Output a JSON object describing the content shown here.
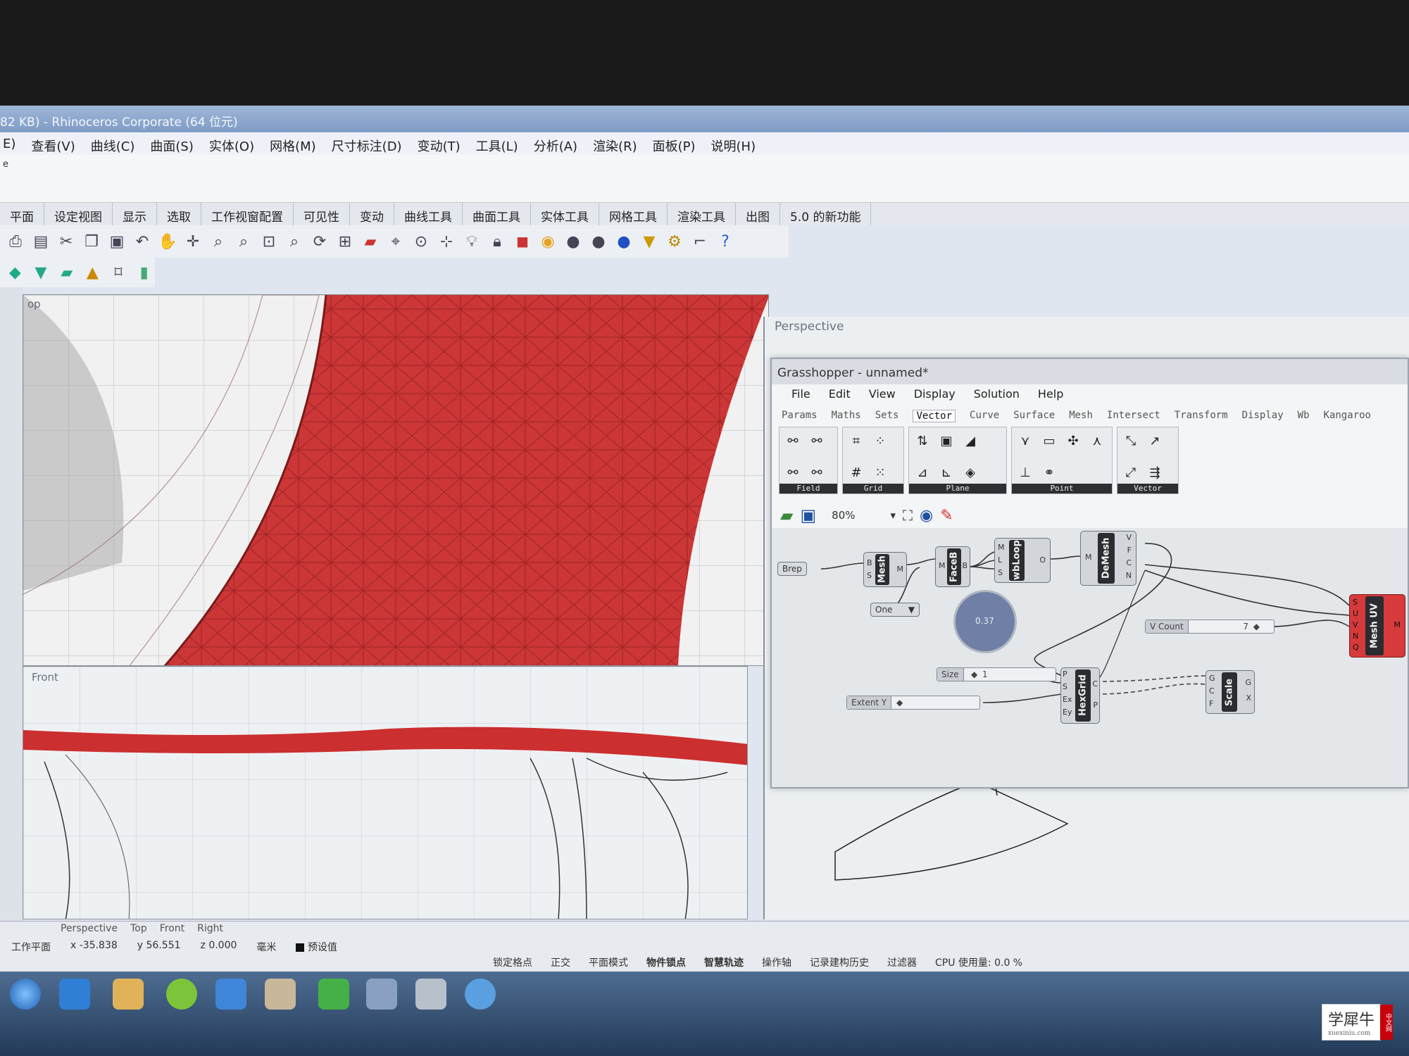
{
  "window": {
    "title": "82 KB) - Rhinoceros Corporate (64 位元)"
  },
  "menubar": {
    "items": [
      "E)",
      "查看(V)",
      "曲线(C)",
      "曲面(S)",
      "实体(O)",
      "网格(M)",
      "尺寸标注(D)",
      "变动(T)",
      "工具(L)",
      "分析(A)",
      "渲染(R)",
      "面板(P)",
      "说明(H)"
    ]
  },
  "command": {
    "prompt": "e"
  },
  "tabbar": {
    "tabs": [
      "平面",
      "设定视图",
      "显示",
      "选取",
      "工作视窗配置",
      "可见性",
      "变动",
      "曲线工具",
      "曲面工具",
      "实体工具",
      "网格工具",
      "渲染工具",
      "出图",
      "5.0 的新功能"
    ]
  },
  "viewports": {
    "top": {
      "label": "op"
    },
    "front": {
      "label": "Front"
    },
    "perspective": {
      "label": "Perspective"
    }
  },
  "grasshopper": {
    "title": "Grasshopper - unnamed*",
    "menu": [
      "File",
      "Edit",
      "View",
      "Display",
      "Solution",
      "Help"
    ],
    "tabs": [
      "Params",
      "Maths",
      "Sets",
      "Vector",
      "Curve",
      "Surface",
      "Mesh",
      "Intersect",
      "Transform",
      "Display",
      "Wb",
      "Kangaroo"
    ],
    "active_tab": "Vector",
    "ribbon_groups": [
      "Field",
      "Grid",
      "Plane",
      "Point",
      "Vector"
    ],
    "zoom": "80%",
    "components": {
      "brep": "Brep",
      "mesh": {
        "name": "Mesh",
        "in": [
          "B",
          "S"
        ],
        "out": [
          "M"
        ]
      },
      "faceb": {
        "name": "FaceB",
        "in": [
          "M"
        ],
        "out": [
          "B"
        ]
      },
      "wbloop": {
        "name": "wbLoop",
        "in": [
          "M",
          "L",
          "S"
        ],
        "out": [
          "O"
        ]
      },
      "demesh": {
        "name": "DeMesh",
        "in": [
          "M"
        ],
        "out": [
          "V",
          "F",
          "C",
          "N"
        ]
      },
      "meshuv": {
        "name": "Mesh UV",
        "in": [
          "S",
          "U",
          "V",
          "N",
          "Q"
        ],
        "out": [
          "M"
        ]
      },
      "hexgrid": {
        "name": "HexGrid",
        "in": [
          "P",
          "S",
          "Ex",
          "Ey"
        ],
        "out": [
          "C",
          "P"
        ]
      },
      "scale": {
        "name": "Scale",
        "in": [
          "G",
          "C",
          "F"
        ],
        "out": [
          "G",
          "X"
        ]
      },
      "value_list": "One",
      "knob_value": "0.37",
      "v_count": {
        "label": "V Count",
        "value": "7"
      },
      "size": {
        "label": "Size",
        "value": "1"
      },
      "extent_y": {
        "label": "Extent Y",
        "value": ""
      }
    }
  },
  "statusbar": {
    "viewport_tabs": [
      "Perspective",
      "Top",
      "Front",
      "Right"
    ],
    "coords": {
      "plane": "工作平面",
      "x": "x -35.838",
      "y": "y 56.551",
      "z": "z 0.000"
    },
    "units": "毫米",
    "layer": "预设值",
    "toggles": [
      "锁定格点",
      "正交",
      "平面模式",
      "物件锁点",
      "智慧轨迹",
      "操作轴",
      "记录建构历史",
      "过滤器"
    ],
    "cpu": "CPU 使用量: 0.0 %"
  },
  "watermark": {
    "title": "学犀牛",
    "url": "xuexiniu.com",
    "tag": "中文网"
  },
  "colors": {
    "mesh_red": "#cc2e2e",
    "title_blue": "#8aa6cf",
    "taskbar": "#2d4a70"
  }
}
